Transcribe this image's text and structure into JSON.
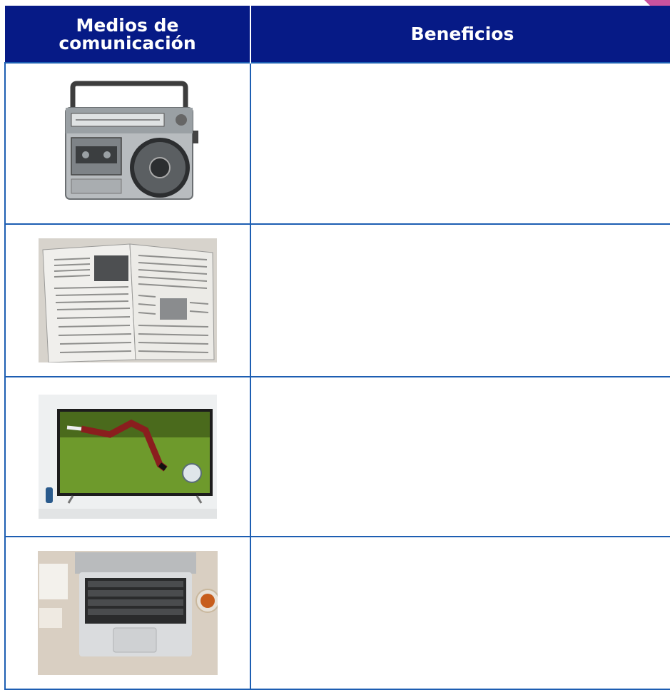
{
  "table": {
    "headers": {
      "media": "Medios de comunicación",
      "benefits": "Beneficios"
    },
    "rows": [
      {
        "media": "radio-image",
        "benefits": ""
      },
      {
        "media": "newspaper-image",
        "benefits": ""
      },
      {
        "media": "television-image",
        "benefits": ""
      },
      {
        "media": "laptop-image",
        "benefits": ""
      }
    ]
  },
  "colors": {
    "header_background": "#061a86",
    "grid_lines": "#1d5eb2",
    "corner_accent": "#c9529e"
  }
}
